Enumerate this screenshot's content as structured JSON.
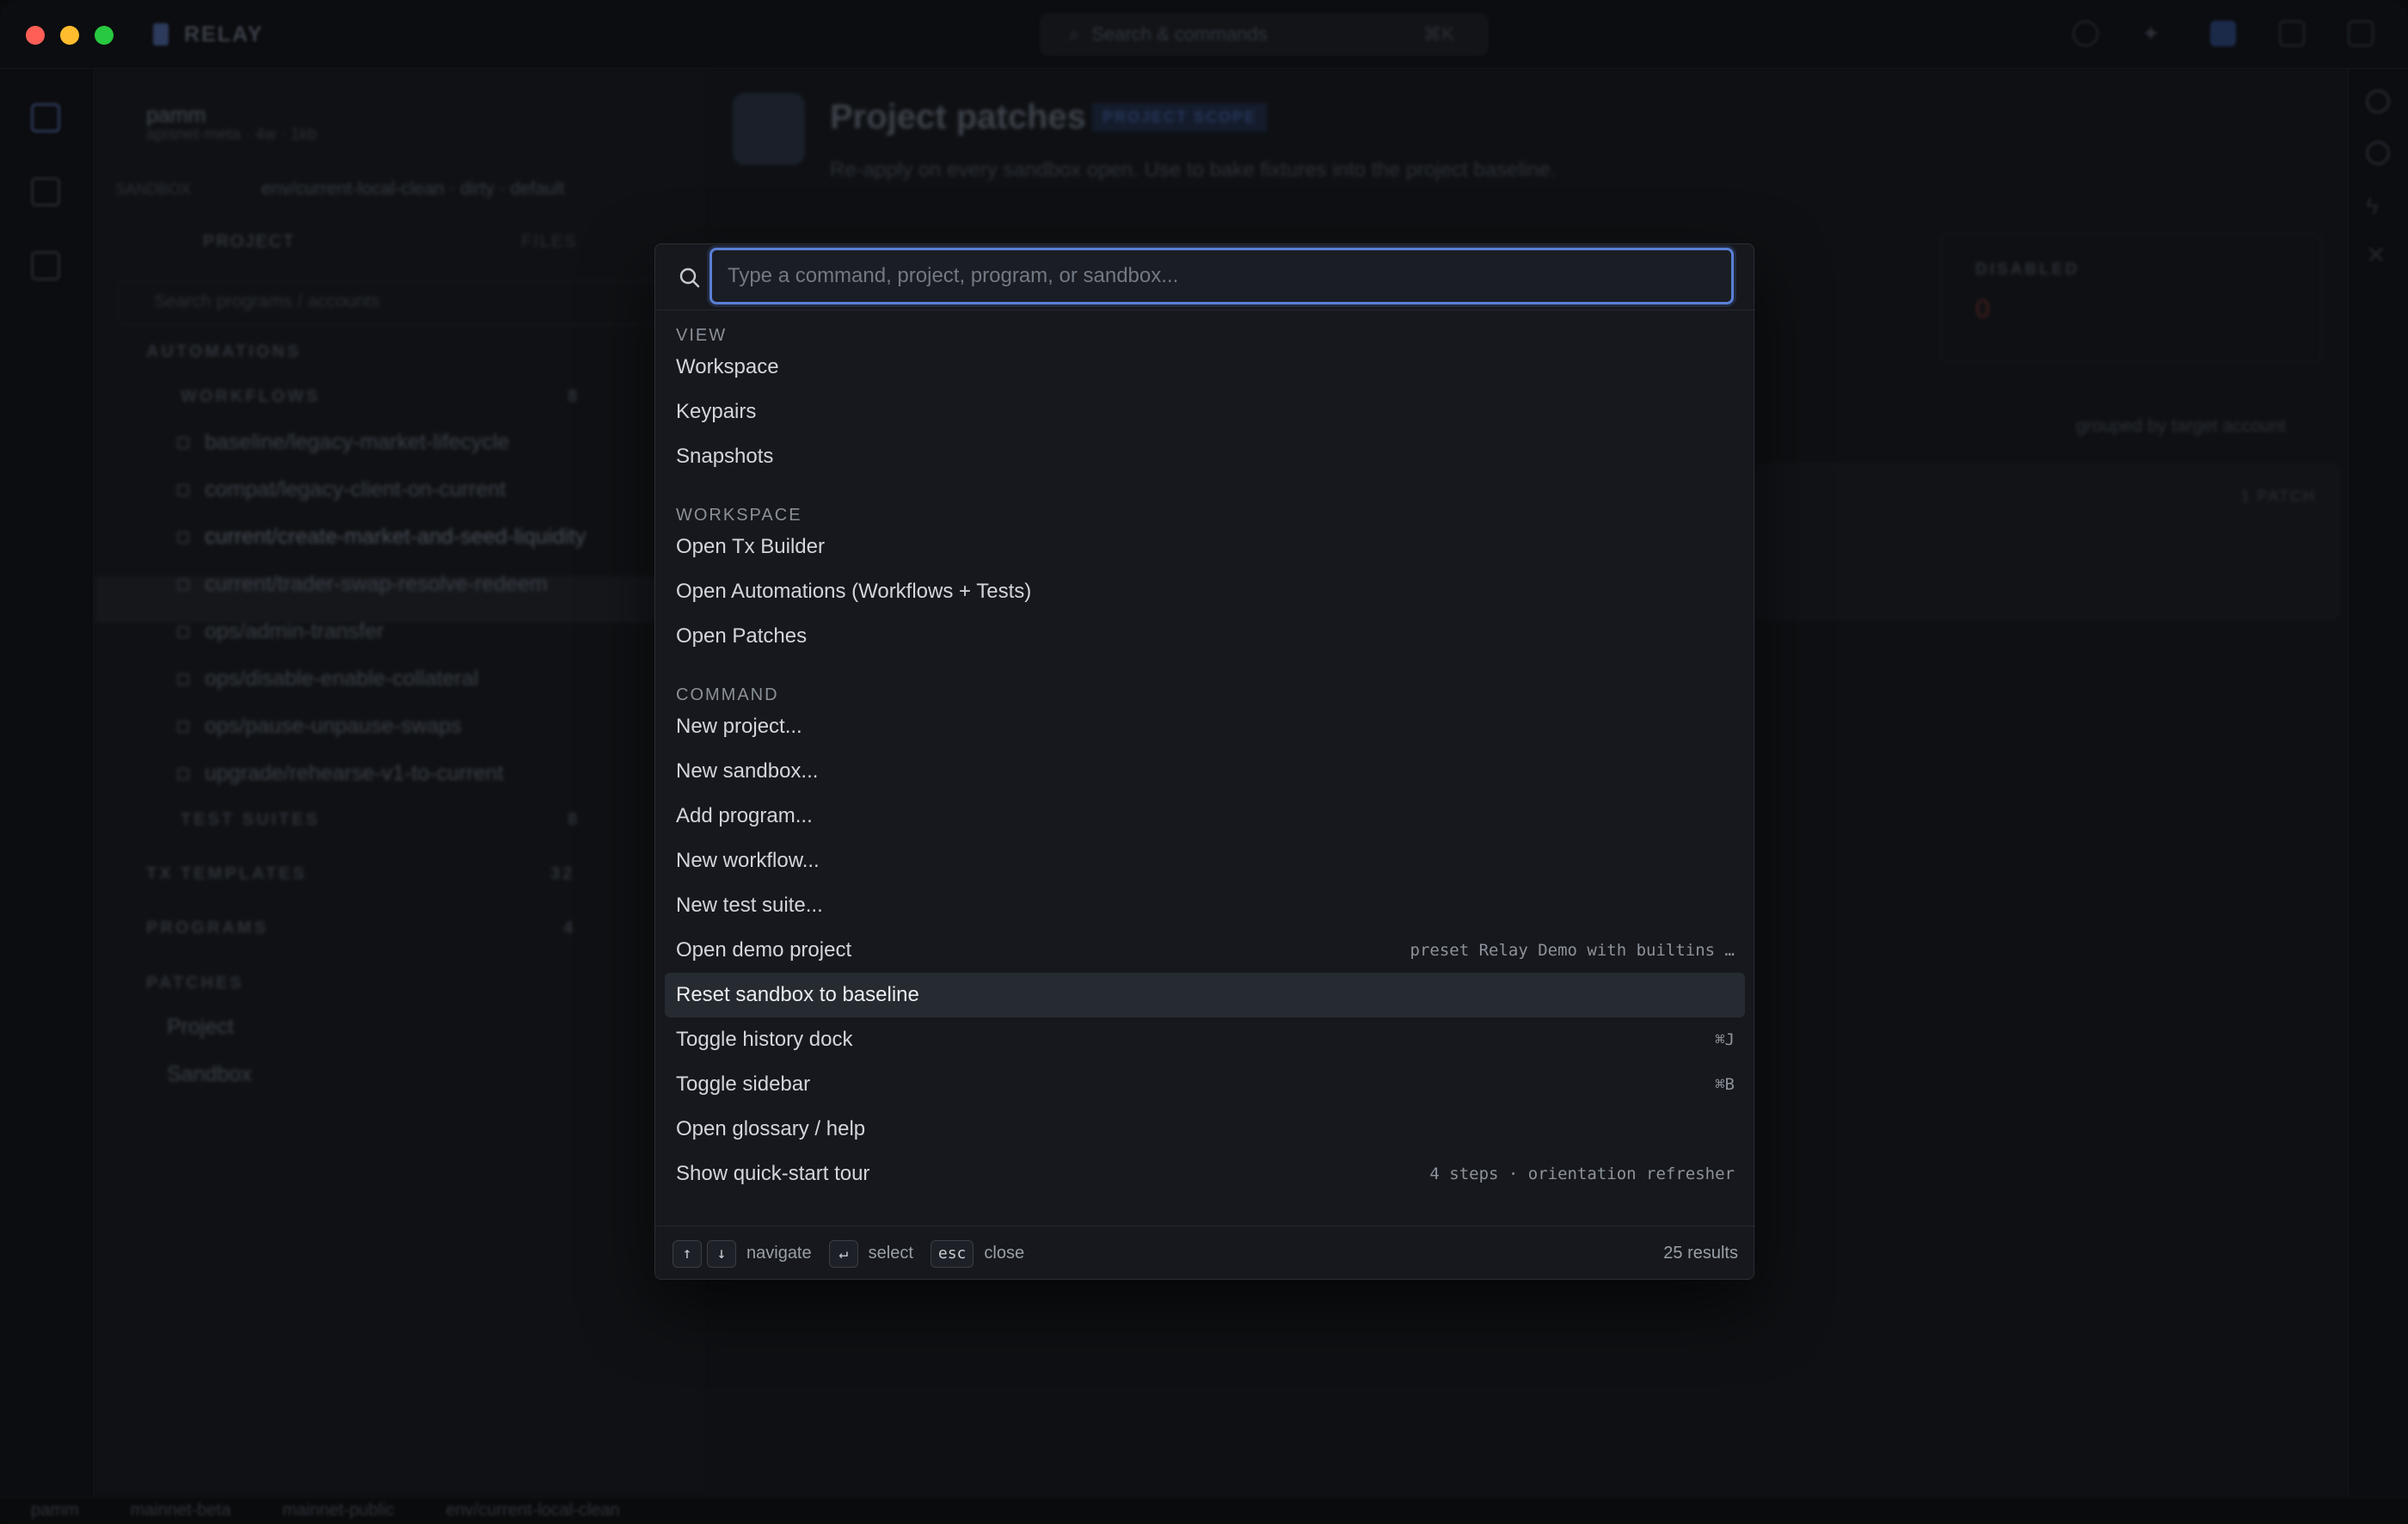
{
  "app": {
    "name": "RELAY",
    "search_placeholder": "Search & commands",
    "search_shortcut": "⌘K"
  },
  "sidebar": {
    "user": "pamm",
    "project_path": "apisnet-meta · 4w · 1kb",
    "sandbox_label": "SANDBOX",
    "sandbox_value": "env/current-local-clean · dirty · default",
    "tabs": [
      "PROJECT",
      "FILES"
    ],
    "search_placeholder": "Search programs / accounts",
    "sections": {
      "automations": "AUTOMATIONS",
      "workflows": "WORKFLOWS",
      "test_suites": "TEST SUITES",
      "tx_templates": "TX TEMPLATES",
      "programs": "PROGRAMS",
      "patches": "PATCHES"
    },
    "counts": {
      "workflows": "8",
      "test_suites": "8",
      "tx_templates": "32",
      "programs": "4"
    },
    "workflows": [
      "baseline/legacy-market-lifecycle",
      "compat/legacy-client-on-current",
      "current/create-market-and-seed-liquidity",
      "current/trader-swap-resolve-redeem",
      "ops/admin-transfer",
      "ops/disable-enable-collateral",
      "ops/pause-unpause-swaps",
      "upgrade/rehearse-v1-to-current"
    ],
    "patches": [
      "Project",
      "Sandbox"
    ]
  },
  "main": {
    "title": "Project patches",
    "badge": "PROJECT SCOPE",
    "subtitle": "Re-apply on every sandbox open. Use to bake fixtures into the project baseline.",
    "disabled_label": "DISABLED",
    "disabled_value": "0",
    "grouped_label": "grouped by target account",
    "patch_count": "1 PATCH"
  },
  "statusbar": [
    "pamm",
    "mainnet-beta",
    "mainnet-public",
    "env/current-local-clean"
  ],
  "palette": {
    "placeholder": "Type a command, project, program, or sandbox...",
    "groups": {
      "view": "VIEW",
      "workspace": "WORKSPACE",
      "command": "COMMAND"
    },
    "view_items": [
      "Workspace",
      "Keypairs",
      "Snapshots"
    ],
    "workspace_items": [
      "Open Tx Builder",
      "Open Automations (Workflows + Tests)",
      "Open Patches"
    ],
    "command_items": [
      {
        "label": "New project...",
        "hint": ""
      },
      {
        "label": "New sandbox...",
        "hint": ""
      },
      {
        "label": "Add program...",
        "hint": ""
      },
      {
        "label": "New workflow...",
        "hint": ""
      },
      {
        "label": "New test suite...",
        "hint": ""
      },
      {
        "label": "Open demo project",
        "hint": "preset Relay Demo with builtins …"
      },
      {
        "label": "Reset sandbox to baseline",
        "hint": ""
      },
      {
        "label": "Toggle history dock",
        "hint": "⌘J"
      },
      {
        "label": "Toggle sidebar",
        "hint": "⌘B"
      },
      {
        "label": "Open glossary / help",
        "hint": ""
      },
      {
        "label": "Show quick-start tour",
        "hint": "4 steps · orientation refresher"
      }
    ],
    "footer": {
      "up_key": "↑",
      "down_key": "↓",
      "navigate": "navigate",
      "enter_key": "↵",
      "select": "select",
      "esc_key": "esc",
      "close": "close",
      "count": "25 results"
    }
  },
  "colors": {
    "accent": "#5a7fd6",
    "selected_row": "#262a31",
    "palette_bg": "#16181d"
  }
}
